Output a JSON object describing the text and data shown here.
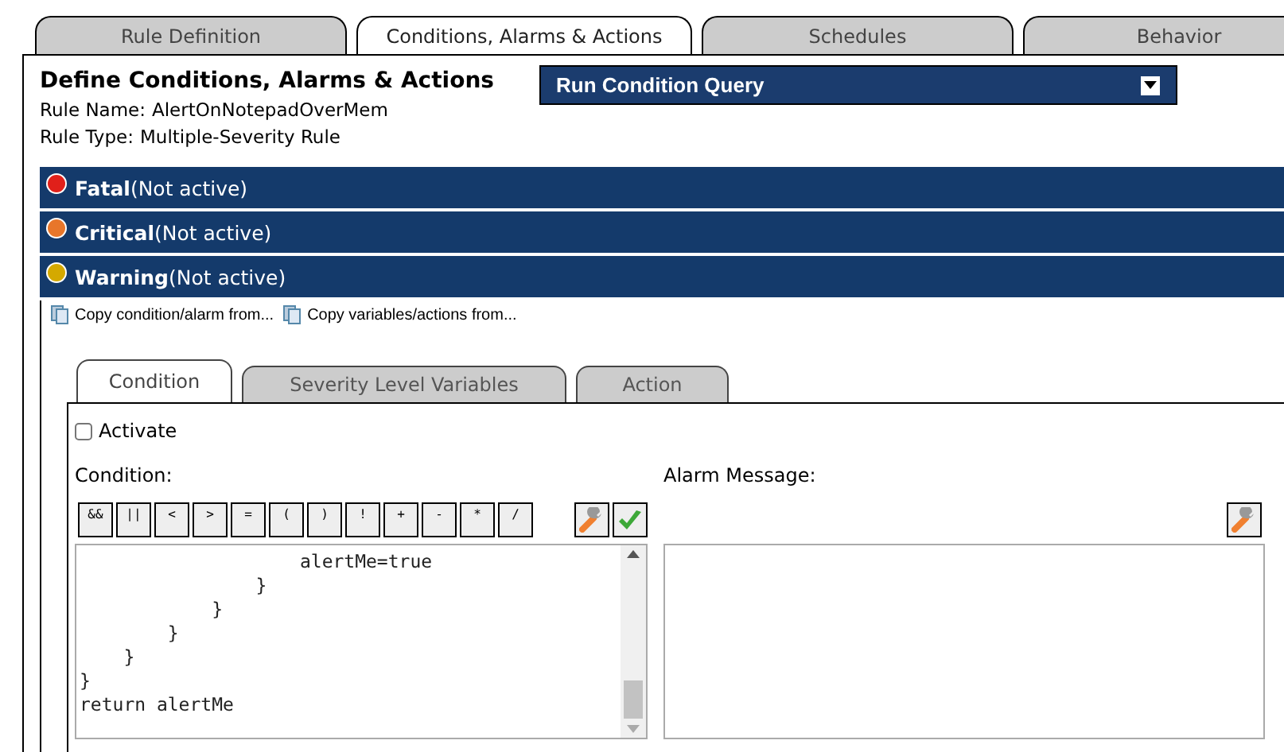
{
  "tabs": [
    {
      "label": "Rule Definition",
      "selected": false
    },
    {
      "label": "Conditions, Alarms & Actions",
      "selected": true
    },
    {
      "label": "Schedules",
      "selected": false
    },
    {
      "label": "Behavior",
      "selected": false
    }
  ],
  "header": {
    "title": "Define Conditions, Alarms & Actions",
    "rule_name_label": "Rule Name:",
    "rule_name": "AlertOnNotepadOverMem",
    "rule_type_label": "Rule Type:",
    "rule_type": "Multiple-Severity Rule"
  },
  "query_dropdown": {
    "label": "Run Condition Query"
  },
  "severities": [
    {
      "name": "Fatal",
      "status": "(Not active)",
      "color": "#e0201a"
    },
    {
      "name": "Critical",
      "status": "(Not active)",
      "color": "#e8762a"
    },
    {
      "name": "Warning",
      "status": "(Not active)",
      "color": "#d4a900"
    }
  ],
  "copy_links": [
    "Copy condition/alarm from...",
    "Copy variables/actions from..."
  ],
  "inner_tabs": [
    {
      "label": "Condition",
      "selected": true
    },
    {
      "label": "Severity Level Variables",
      "selected": false
    },
    {
      "label": "Action",
      "selected": false
    }
  ],
  "activate": {
    "label": "Activate",
    "checked": false
  },
  "condition": {
    "label": "Condition:",
    "operators": [
      "&&",
      "||",
      "<",
      ">",
      "=",
      "(",
      ")",
      "!",
      "+",
      "-",
      "*",
      "/"
    ],
    "code_lines": [
      "                    alertMe=true",
      "                }",
      "            }",
      "        }",
      "    }",
      "}",
      "return alertMe"
    ]
  },
  "alarm_message": {
    "label": "Alarm Message:"
  }
}
